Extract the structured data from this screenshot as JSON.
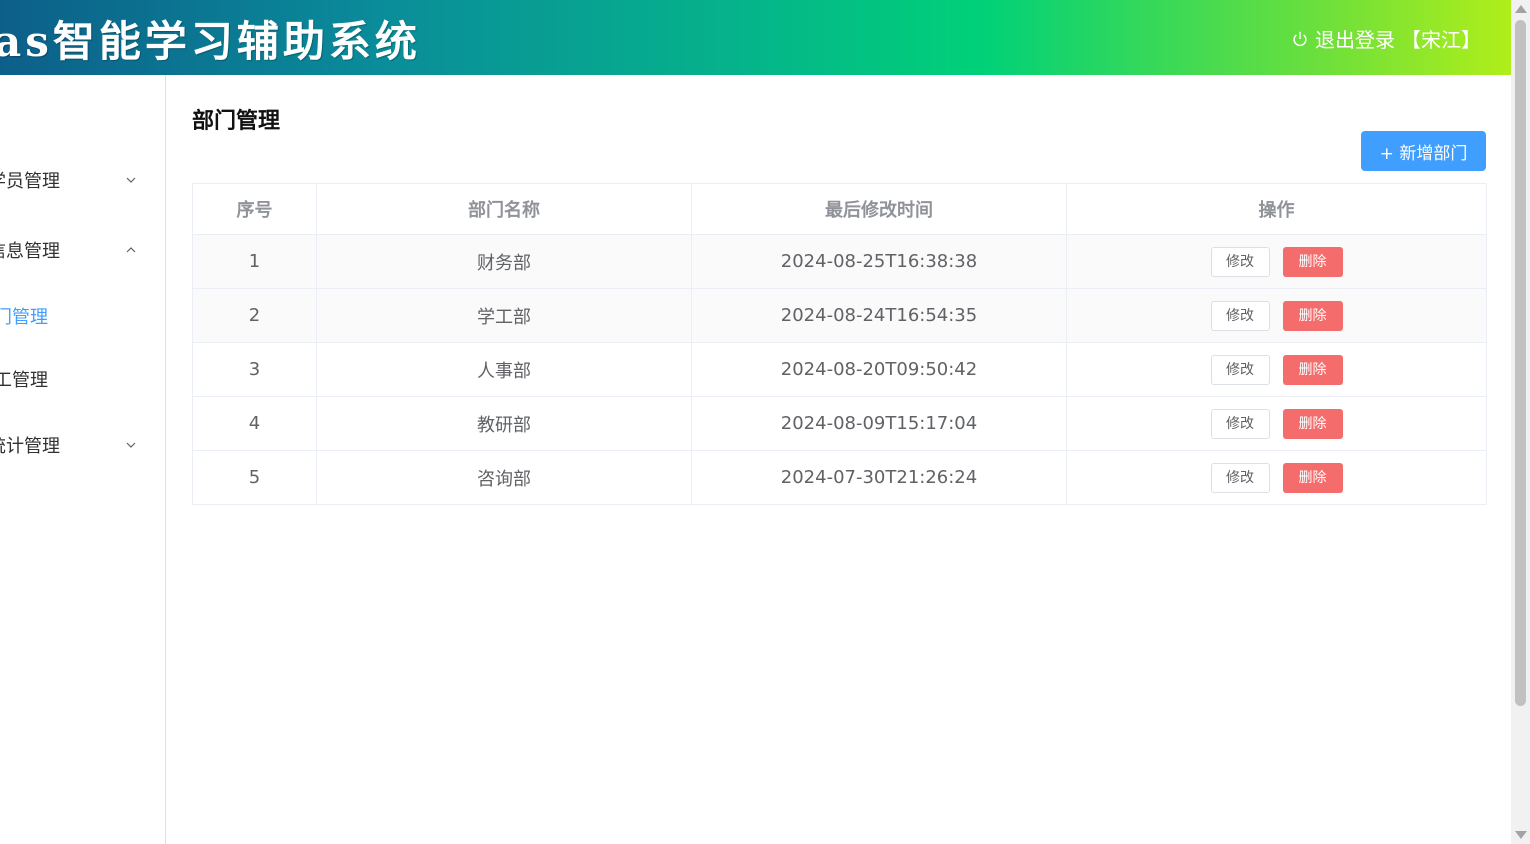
{
  "header": {
    "app_title": "as智能学习辅助系统",
    "logout_label": "退出登录",
    "user_label": "【宋江】"
  },
  "sidebar": {
    "items": [
      {
        "label": "学员管理",
        "expanded": false
      },
      {
        "label": "信息管理",
        "expanded": true
      },
      {
        "label": "门管理",
        "active": true
      },
      {
        "label": "工管理"
      },
      {
        "label": "统计管理",
        "expanded": false
      }
    ]
  },
  "main": {
    "page_title": "部门管理",
    "add_button": "+ 新增部门",
    "table": {
      "headers": [
        "序号",
        "部门名称",
        "最后修改时间",
        "操作"
      ],
      "rows": [
        {
          "index": "1",
          "name": "财务部",
          "updated": "2024-08-25T16:38:38"
        },
        {
          "index": "2",
          "name": "学工部",
          "updated": "2024-08-24T16:54:35"
        },
        {
          "index": "3",
          "name": "人事部",
          "updated": "2024-08-20T09:50:42"
        },
        {
          "index": "4",
          "name": "教研部",
          "updated": "2024-08-09T15:17:04"
        },
        {
          "index": "5",
          "name": "咨询部",
          "updated": "2024-07-30T21:26:24"
        }
      ],
      "edit_label": "修改",
      "delete_label": "删除"
    }
  },
  "colors": {
    "primary": "#409eff",
    "danger": "#f56c6c"
  }
}
